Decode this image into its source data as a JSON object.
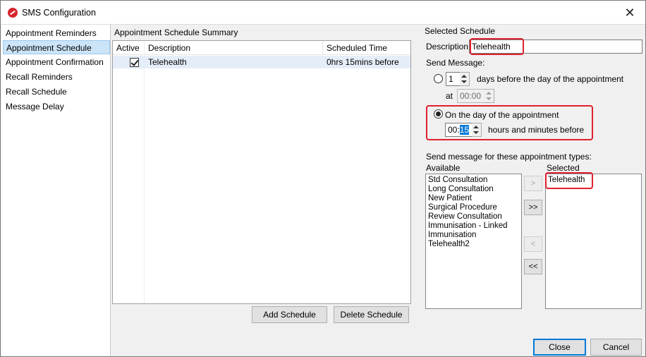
{
  "window": {
    "title": "SMS Configuration"
  },
  "nav": {
    "items": [
      {
        "label": "Appointment Reminders",
        "selected": false
      },
      {
        "label": "Appointment Schedule",
        "selected": true
      },
      {
        "label": "Appointment Confirmation",
        "selected": false
      },
      {
        "label": "Recall Reminders",
        "selected": false
      },
      {
        "label": "Recall Schedule",
        "selected": false
      },
      {
        "label": "Message Delay",
        "selected": false
      }
    ]
  },
  "summary": {
    "title": "Appointment Schedule Summary",
    "columns": [
      "Active",
      "Description",
      "Scheduled Time"
    ],
    "rows": [
      {
        "active": true,
        "description": "Telehealth",
        "scheduled_time": "0hrs 15mins before"
      }
    ],
    "add_button": "Add Schedule",
    "delete_button": "Delete Schedule"
  },
  "selected_schedule": {
    "title": "Selected Schedule",
    "description_label": "Description",
    "description_value": "Telehealth",
    "send_message_label": "Send Message:",
    "option_days": {
      "value": "1",
      "suffix": "days before the day of the appointment",
      "at_label": "at",
      "at_value": "00:00",
      "selected": false
    },
    "option_same_day": {
      "label": "On the day of the appointment",
      "hours": "00:",
      "minutes": "15",
      "suffix": "hours and minutes before",
      "selected": true
    },
    "types_label": "Send message for these appointment types:",
    "available_label": "Available",
    "selected_label": "Selected",
    "available": [
      "Std Consultation",
      "Long Consultation",
      "New Patient",
      "Surgical Procedure",
      "Review Consultation",
      "Immunisation - Linked",
      "Immunisation",
      "Telehealth2"
    ],
    "selected": [
      "Telehealth"
    ],
    "move_buttons": {
      "add_one": ">",
      "add_all": ">>",
      "remove_one": "<",
      "remove_all": "<<"
    }
  },
  "footer": {
    "close": "Close",
    "cancel": "Cancel"
  },
  "colors": {
    "highlight_red": "#e0212e",
    "selection_blue": "#0078d7",
    "nav_selected": "#cce4f7"
  }
}
